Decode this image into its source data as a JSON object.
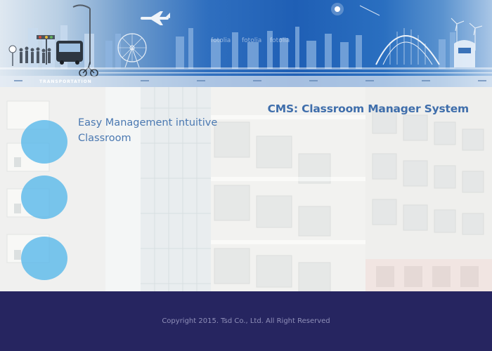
{
  "banner": {
    "caption": "TRANSPORTATION",
    "watermarks": [
      "fotolia",
      "fotolia",
      "fotolia"
    ]
  },
  "header": {
    "system_title": "CMS: Classroom Manager System"
  },
  "intro": {
    "tagline_line1": "Easy Management intuitive",
    "tagline_line2": "Classroom"
  },
  "side_menu": {
    "buttons": [
      "circle-button-1",
      "circle-button-2",
      "circle-button-3"
    ]
  },
  "footer": {
    "copyright": "Copyright 2015. Tsd Co., Ltd. All Right Reserved"
  },
  "colors": {
    "banner_blue": "#1f5fb5",
    "title_blue": "#3f6eab",
    "tagline_blue": "#4a78b1",
    "circle_cyan": "#5cb9ea",
    "footer_navy": "#262560",
    "footer_text": "#8f8fb8"
  }
}
